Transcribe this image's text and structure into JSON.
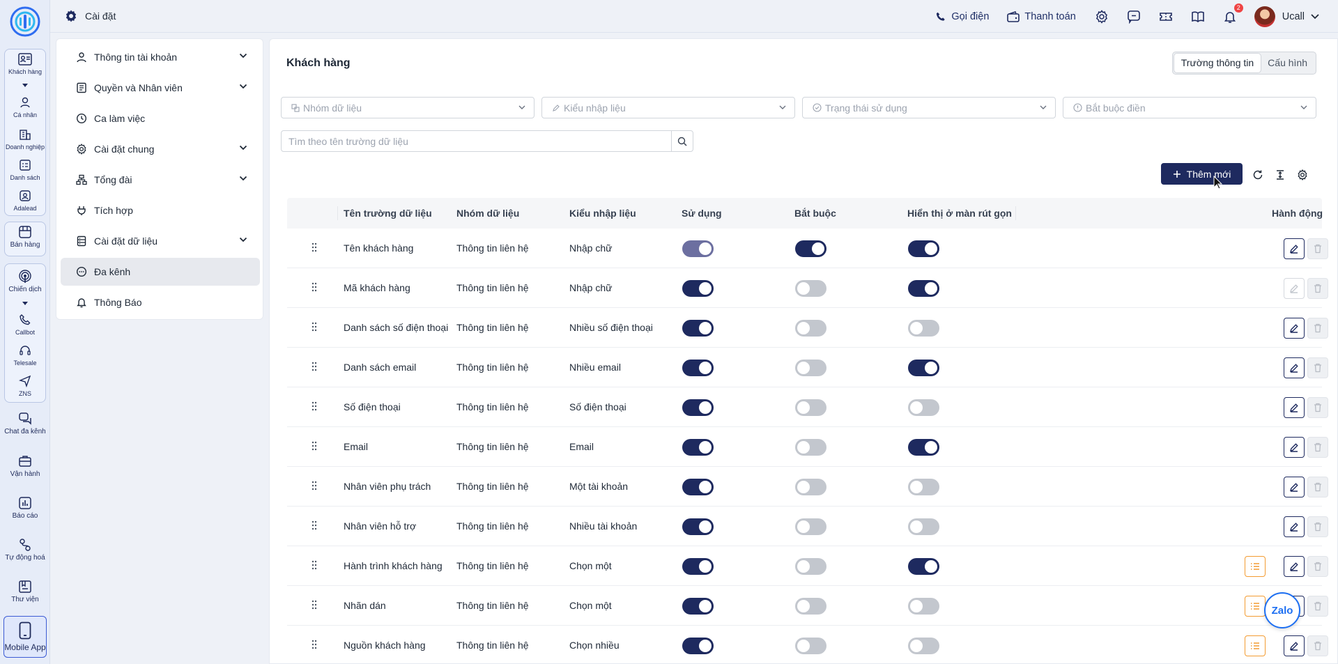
{
  "colors": {
    "primary": "#1e2a5f",
    "accent_orange": "#f39c32",
    "toggle_off": "#c3c7ce"
  },
  "rail": {
    "items": [
      {
        "label": "Khách hàng",
        "icon": "contact-card-icon"
      },
      {
        "label": "Cá nhân",
        "icon": "person-icon"
      },
      {
        "label": "Doanh nghiệp",
        "icon": "building-icon"
      },
      {
        "label": "Danh sách",
        "icon": "list-icon"
      },
      {
        "label": "Adalead",
        "icon": "user-square-icon"
      },
      {
        "label": "Bán hàng",
        "icon": "shop-icon"
      },
      {
        "label": "Chiến dịch",
        "icon": "broadcast-icon"
      },
      {
        "label": "Callbot",
        "icon": "phone-icon"
      },
      {
        "label": "Telesale",
        "icon": "headset-icon"
      },
      {
        "label": "ZNS",
        "icon": "send-icon"
      },
      {
        "label": "Chat đa kênh",
        "icon": "chat-icon"
      },
      {
        "label": "Vận hành",
        "icon": "briefcase-icon"
      },
      {
        "label": "Báo cáo",
        "icon": "chart-icon"
      },
      {
        "label": "Tự động hoá",
        "icon": "flow-icon"
      },
      {
        "label": "Thư viện",
        "icon": "library-icon"
      }
    ],
    "mobile_label": "Mobile App"
  },
  "header": {
    "title": "Cài đặt",
    "call_label": "Gọi điện",
    "payment_label": "Thanh toán",
    "notification_count": "2",
    "user_name": "Ucall"
  },
  "menu": {
    "items": [
      {
        "label": "Thông tin tài khoản",
        "icon": "user-icon",
        "expandable": true
      },
      {
        "label": "Quyền và Nhân viên",
        "icon": "document-list-icon",
        "expandable": true
      },
      {
        "label": "Ca làm việc",
        "icon": "clock-icon",
        "expandable": false
      },
      {
        "label": "Cài đặt chung",
        "icon": "gear-icon",
        "expandable": true
      },
      {
        "label": "Tổng đài",
        "icon": "hierarchy-icon",
        "expandable": true
      },
      {
        "label": "Tích hợp",
        "icon": "plug-icon",
        "expandable": false
      },
      {
        "label": "Cài đặt dữ liệu",
        "icon": "database-icon",
        "expandable": true
      },
      {
        "label": "Đa kênh",
        "icon": "chat-bubble-icon",
        "expandable": false,
        "active": true
      },
      {
        "label": "Thông Báo",
        "icon": "bell-icon",
        "expandable": false
      }
    ]
  },
  "main": {
    "title": "Khách hàng",
    "tabs": [
      {
        "label": "Trường thông tin",
        "active": true
      },
      {
        "label": "Cấu hình",
        "active": false
      }
    ],
    "filters": [
      {
        "placeholder": "Nhóm dữ liệu"
      },
      {
        "placeholder": "Kiểu nhập liệu"
      },
      {
        "placeholder": "Trạng thái sử dụng"
      },
      {
        "placeholder": "Bắt buộc điền"
      }
    ],
    "search_placeholder": "Tìm theo tên trường dữ liệu",
    "add_label": "Thêm mới"
  },
  "table": {
    "headers": [
      "Tên trường dữ liệu",
      "Nhóm dữ liệu",
      "Kiểu nhập liệu",
      "Sử dụng",
      "Bắt buộc",
      "Hiển thị ở màn rút gọn",
      "Hành động"
    ],
    "rows": [
      {
        "name": "Tên khách hàng",
        "group": "Thông tin liên hệ",
        "type": "Nhập chữ",
        "use": "dim",
        "required": true,
        "compact": true,
        "list": false,
        "edit_disabled": false
      },
      {
        "name": "Mã khách hàng",
        "group": "Thông tin liên hệ",
        "type": "Nhập chữ",
        "use": "on",
        "required": false,
        "compact": true,
        "list": false,
        "edit_disabled": true
      },
      {
        "name": "Danh sách số điện thoại",
        "group": "Thông tin liên hệ",
        "type": "Nhiều số điện thoại",
        "use": "on",
        "required": false,
        "compact": false,
        "list": false,
        "edit_disabled": false
      },
      {
        "name": "Danh sách email",
        "group": "Thông tin liên hệ",
        "type": "Nhiều email",
        "use": "on",
        "required": false,
        "compact": true,
        "list": false,
        "edit_disabled": false
      },
      {
        "name": "Số điện thoại",
        "group": "Thông tin liên hệ",
        "type": "Số điện thoại",
        "use": "on",
        "required": false,
        "compact": false,
        "list": false,
        "edit_disabled": false
      },
      {
        "name": "Email",
        "group": "Thông tin liên hệ",
        "type": "Email",
        "use": "on",
        "required": false,
        "compact": true,
        "list": false,
        "edit_disabled": false
      },
      {
        "name": "Nhân viên phụ trách",
        "group": "Thông tin liên hệ",
        "type": "Một tài khoản",
        "use": "on",
        "required": false,
        "compact": false,
        "list": false,
        "edit_disabled": false
      },
      {
        "name": "Nhân viên hỗ trợ",
        "group": "Thông tin liên hệ",
        "type": "Nhiều tài khoản",
        "use": "on",
        "required": false,
        "compact": false,
        "list": false,
        "edit_disabled": false
      },
      {
        "name": "Hành trình khách hàng",
        "group": "Thông tin liên hệ",
        "type": "Chọn một",
        "use": "on",
        "required": false,
        "compact": true,
        "list": true,
        "edit_disabled": false
      },
      {
        "name": "Nhãn dán",
        "group": "Thông tin liên hệ",
        "type": "Chọn một",
        "use": "on",
        "required": false,
        "compact": false,
        "list": true,
        "edit_disabled": false
      },
      {
        "name": "Nguồn khách hàng",
        "group": "Thông tin liên hệ",
        "type": "Chọn nhiều",
        "use": "on",
        "required": false,
        "compact": false,
        "list": true,
        "edit_disabled": false
      }
    ]
  },
  "zalo_label": "Zalo"
}
